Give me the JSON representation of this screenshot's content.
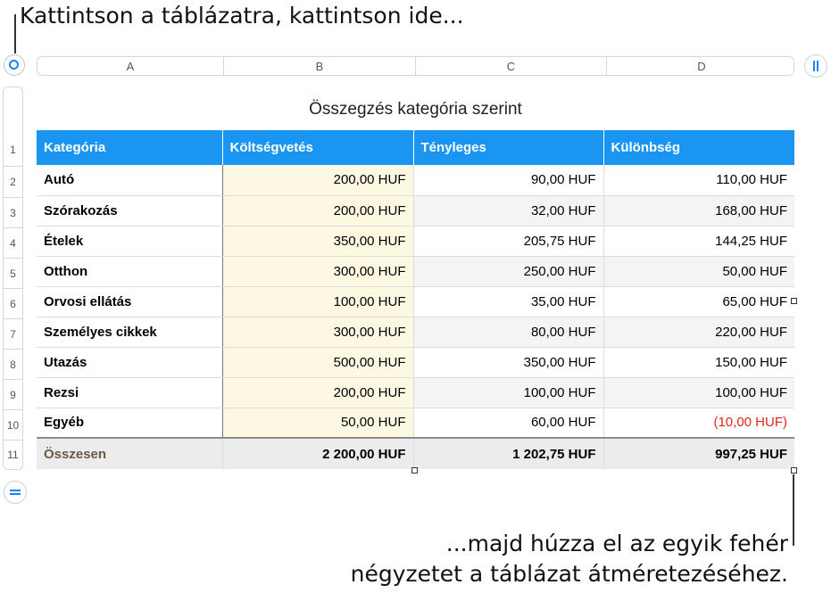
{
  "callouts": {
    "top": "Kattintson a táblázatra, kattintson ide...",
    "bottom_line1": "...majd húzza el az egyik fehér",
    "bottom_line2": "négyzetet a táblázat átméretezéséhez."
  },
  "column_headers": [
    "A",
    "B",
    "C",
    "D"
  ],
  "row_headers": [
    "1",
    "2",
    "3",
    "4",
    "5",
    "6",
    "7",
    "8",
    "9",
    "10",
    "11"
  ],
  "table": {
    "title": "Összegzés kategória szerint",
    "header": [
      "Kategória",
      "Költségvetés",
      "Tényleges",
      "Különbség"
    ],
    "rows": [
      [
        "Autó",
        "200,00 HUF",
        "90,00 HUF",
        "110,00 HUF"
      ],
      [
        "Szórakozás",
        "200,00 HUF",
        "32,00 HUF",
        "168,00 HUF"
      ],
      [
        "Ételek",
        "350,00 HUF",
        "205,75 HUF",
        "144,25 HUF"
      ],
      [
        "Otthon",
        "300,00 HUF",
        "250,00 HUF",
        "50,00 HUF"
      ],
      [
        "Orvosi ellátás",
        "100,00 HUF",
        "35,00 HUF",
        "65,00 HUF"
      ],
      [
        "Személyes cikkek",
        "300,00 HUF",
        "80,00 HUF",
        "220,00 HUF"
      ],
      [
        "Utazás",
        "500,00 HUF",
        "350,00 HUF",
        "150,00 HUF"
      ],
      [
        "Rezsi",
        "200,00 HUF",
        "100,00 HUF",
        "100,00 HUF"
      ],
      [
        "Egyéb",
        "50,00 HUF",
        "60,00 HUF",
        "(10,00 HUF)"
      ]
    ],
    "footer": [
      "Összesen",
      "2 200,00 HUF",
      "1 202,75 HUF",
      "997,25 HUF"
    ]
  },
  "colors": {
    "header_blue": "#1a96f2",
    "budget_highlight": "#fcf8e1",
    "negative_red": "#e0281b",
    "footer_label": "#6b5a44",
    "handle_blue": "#1a84f5"
  },
  "icons": {
    "table_select": "circle-select-icon",
    "add_column": "double-bar-icon",
    "add_row": "double-line-icon"
  }
}
